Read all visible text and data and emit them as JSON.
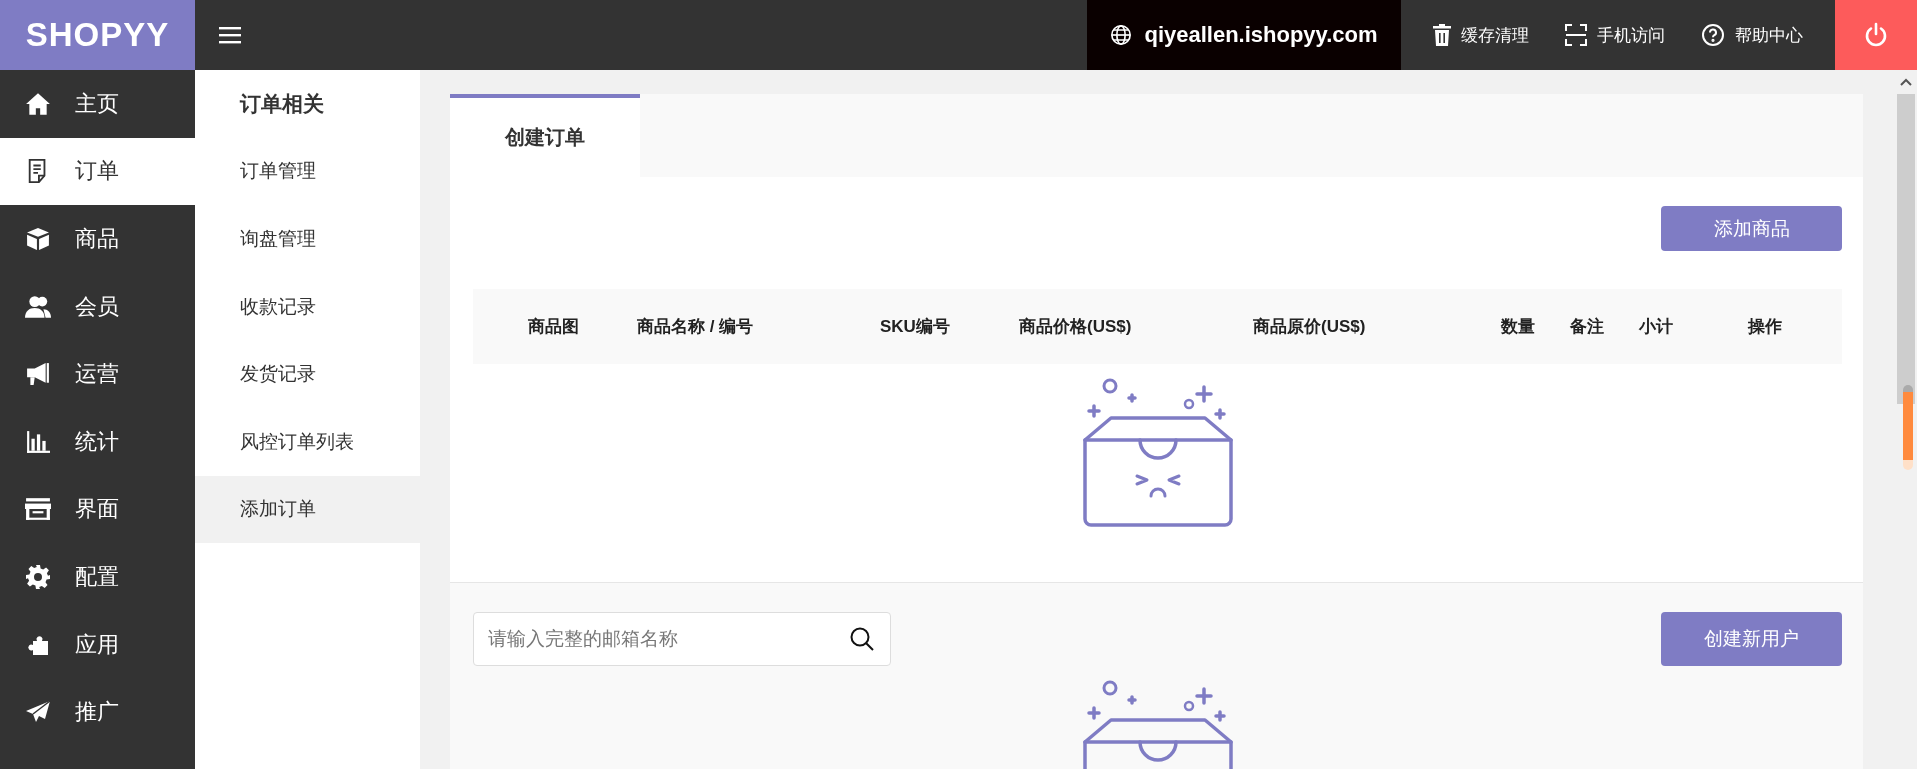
{
  "logo": "SHOPYY",
  "topbar": {
    "domain": "qiyeallen.ishopyy.com",
    "actions": [
      {
        "kind": "trash",
        "label": "缓存清理"
      },
      {
        "kind": "scan",
        "label": "手机访问"
      },
      {
        "kind": "help",
        "label": "帮助中心"
      }
    ]
  },
  "sidebar": {
    "items": [
      {
        "label": "主页",
        "selected": false
      },
      {
        "label": "订单",
        "selected": true
      },
      {
        "label": "商品",
        "selected": false
      },
      {
        "label": "会员",
        "selected": false
      },
      {
        "label": "运营",
        "selected": false
      },
      {
        "label": "统计",
        "selected": false
      },
      {
        "label": "界面",
        "selected": false
      },
      {
        "label": "配置",
        "selected": false
      },
      {
        "label": "应用",
        "selected": false
      },
      {
        "label": "推广",
        "selected": false
      }
    ]
  },
  "submenu": {
    "heading": "订单相关",
    "items": [
      {
        "label": "订单管理",
        "selected": false
      },
      {
        "label": "询盘管理",
        "selected": false
      },
      {
        "label": "收款记录",
        "selected": false
      },
      {
        "label": "发货记录",
        "selected": false
      },
      {
        "label": "风控订单列表",
        "selected": false
      },
      {
        "label": "添加订单",
        "selected": true
      }
    ]
  },
  "tabs": [
    {
      "label": "创建订单",
      "selected": true
    }
  ],
  "products": {
    "add_button": "添加商品",
    "columns": [
      "商品图",
      "商品名称 / 编号",
      "SKU编号",
      "商品价格(US$)",
      "商品原价(US$)",
      "数量",
      "备注",
      "小计",
      "操作"
    ]
  },
  "customer": {
    "search": {
      "placeholder": "请输入完整的邮箱名称"
    },
    "create_button": "创建新用户"
  }
}
